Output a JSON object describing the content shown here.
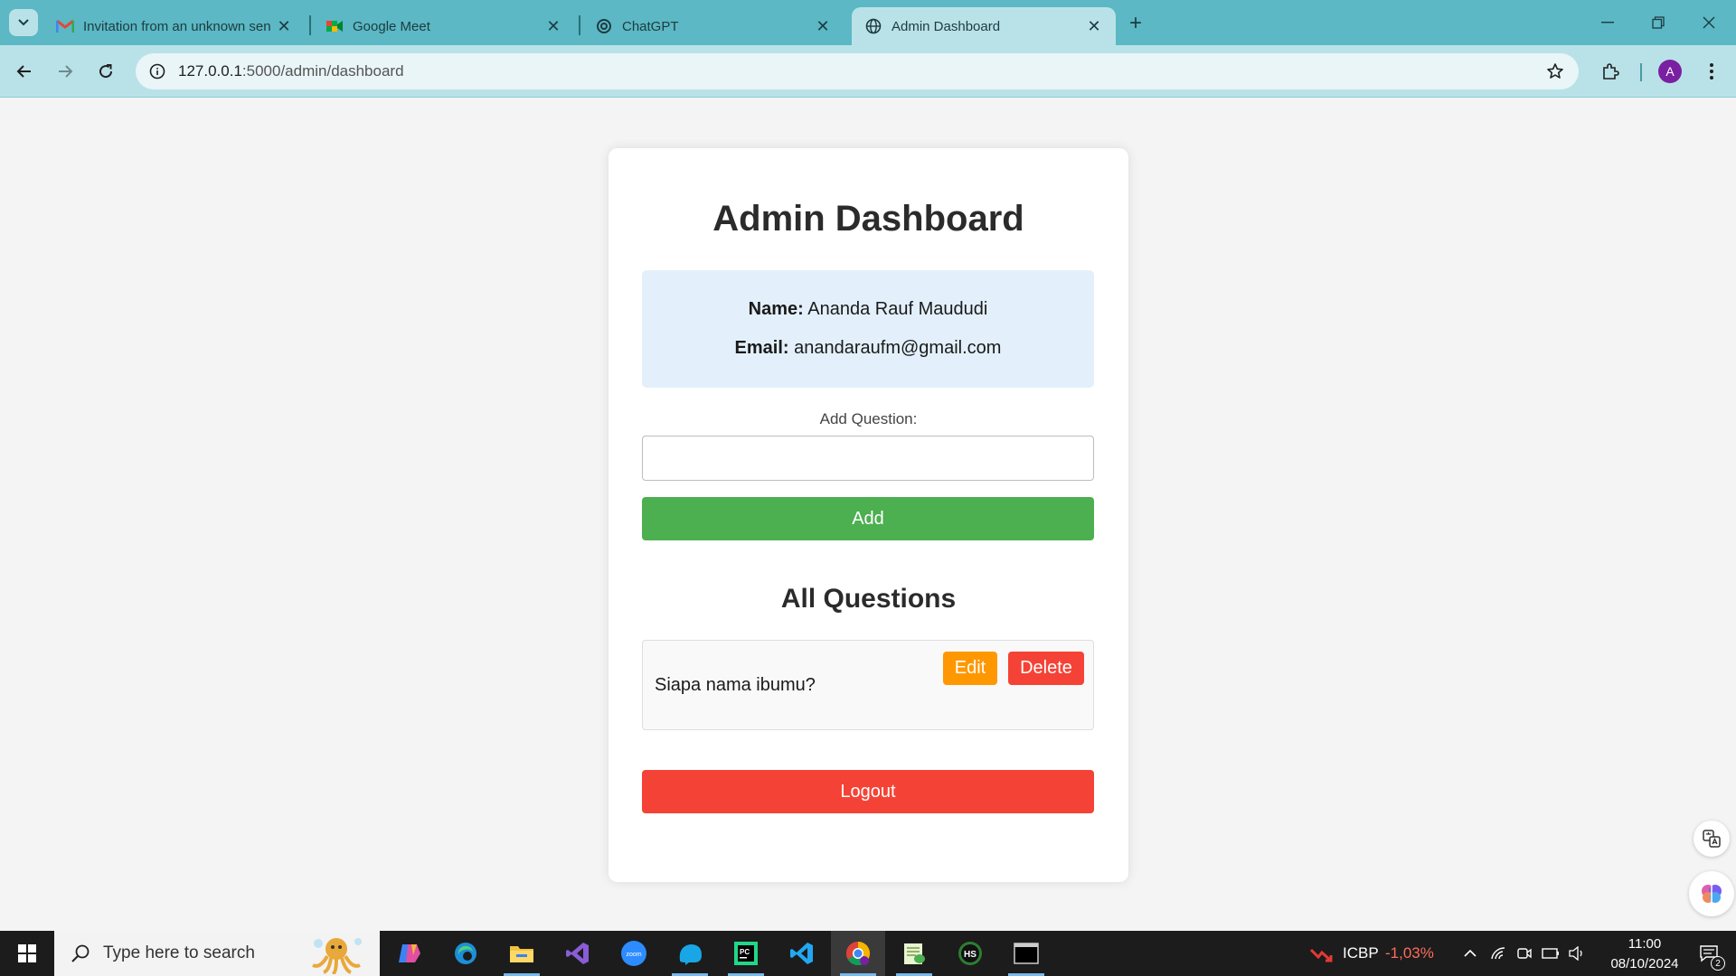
{
  "browser": {
    "tabs": [
      {
        "title": "Invitation from an unknown sen",
        "icon": "gmail-icon"
      },
      {
        "title": "Google Meet",
        "icon": "google-meet-icon"
      },
      {
        "title": "ChatGPT",
        "icon": "chatgpt-icon"
      },
      {
        "title": "Admin Dashboard",
        "icon": "globe-icon"
      }
    ],
    "active_tab": 3,
    "url_host": "127.0.0.1",
    "url_path": ":5000/admin/dashboard",
    "avatar_letter": "A"
  },
  "page": {
    "title": "Admin Dashboard",
    "profile": {
      "name_label": "Name:",
      "name_value": "Ananda Rauf Maududi",
      "email_label": "Email:",
      "email_value": "anandaraufm@gmail.com"
    },
    "add_question_label": "Add Question:",
    "add_question_value": "",
    "add_button": "Add",
    "questions_heading": "All Questions",
    "questions": [
      {
        "text": "Siapa nama ibumu?",
        "edit_label": "Edit",
        "delete_label": "Delete"
      }
    ],
    "logout_button": "Logout"
  },
  "taskbar": {
    "search_placeholder": "Type here to search",
    "stock_ticker": "ICBP",
    "stock_change": "-1,03%",
    "time": "11:00",
    "date": "08/10/2024",
    "notification_count": "2"
  },
  "colors": {
    "tabbar": "#5bb8c4",
    "toolbar": "#b9e2e8",
    "add_button": "#4caf50",
    "edit_button": "#ff9800",
    "delete_button": "#f44336",
    "logout_button": "#f44336",
    "info_box": "#e3f0fb"
  }
}
